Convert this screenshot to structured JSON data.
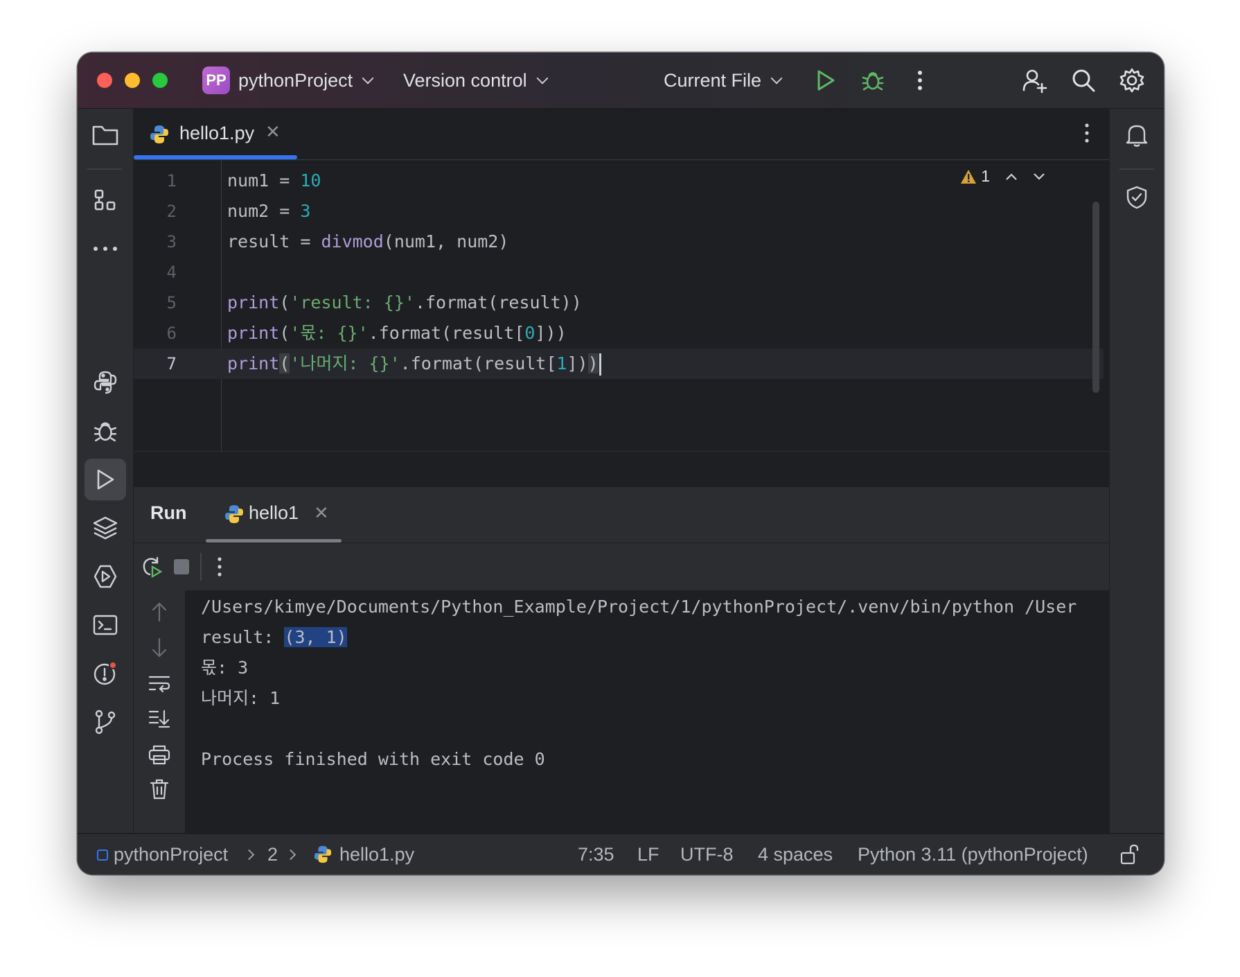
{
  "titlebar": {
    "project_badge": "PP",
    "project_name": "pythonProject",
    "vcs_label": "Version control",
    "run_config": "Current File",
    "icons": [
      "run-icon",
      "debug-icon",
      "more-icon",
      "add-user-icon",
      "search-icon",
      "settings-icon"
    ]
  },
  "editor": {
    "tab_label": "hello1.py",
    "warning_count": "1",
    "line_numbers": [
      "1",
      "2",
      "3",
      "4",
      "5",
      "6",
      "7"
    ],
    "cursor_line": 7
  },
  "run_panel": {
    "title": "Run",
    "tab_label": "hello1",
    "console": {
      "command": "/Users/kimye/Documents/Python_Example/Project/1/pythonProject/.venv/bin/python /User",
      "line1_prefix": "result: ",
      "line1_selected": "(3, 1)",
      "line2": "몫: 3",
      "line3": "나머지: 1",
      "exit_line": "Process finished with exit code 0"
    }
  },
  "statusbar": {
    "crumb_project": "pythonProject",
    "crumb_folder": "2",
    "crumb_file": "hello1.py",
    "position": "7:35",
    "line_sep": "LF",
    "encoding": "UTF-8",
    "indent": "4 spaces",
    "interpreter": "Python 3.11 (pythonProject)"
  },
  "colors": {
    "accent": "#3574f0",
    "string": "#6aab73",
    "number": "#2aacb8",
    "function": "#b09cd9",
    "run_green": "#5fb865",
    "selection": "#214283"
  }
}
